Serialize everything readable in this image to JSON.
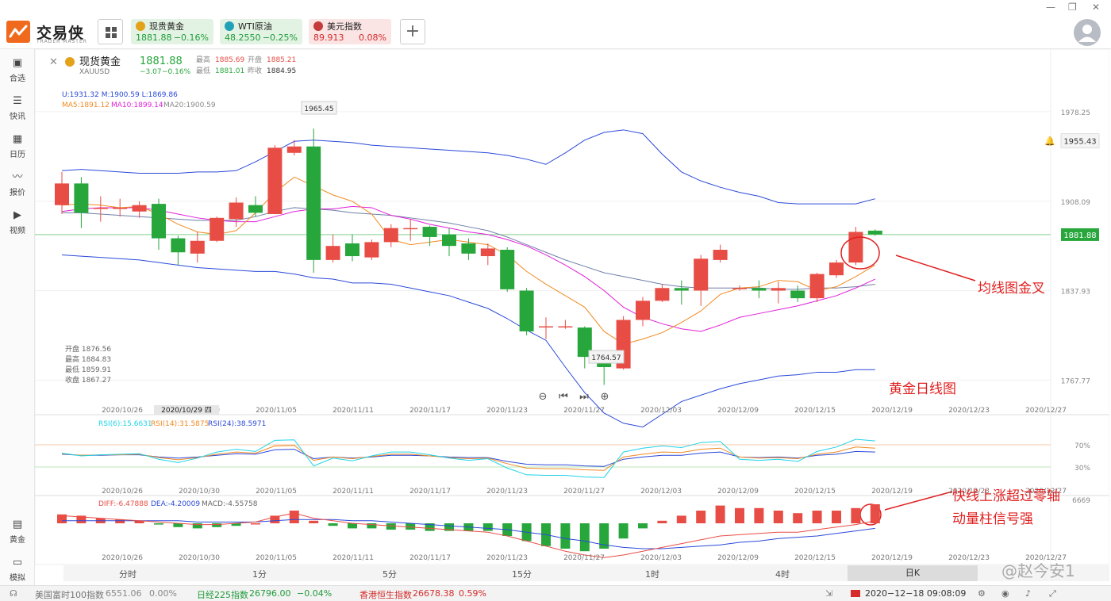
{
  "app": {
    "logo_text": "交易侠",
    "logo_sub": "TRADER MASTER",
    "plus_label": "+",
    "window_controls": [
      "—",
      "❐",
      "✕"
    ]
  },
  "tickers": [
    {
      "name": "现贵黄金",
      "price": "1881.88",
      "change": "−0.16%",
      "bg": "#e3f3e3",
      "price_color": "#1f9b3a",
      "icon_color": "#e3a21a"
    },
    {
      "name": "WTI原油",
      "price": "48.2550",
      "change": "−0.25%",
      "bg": "#e3f3e3",
      "price_color": "#1f9b3a",
      "icon_color": "#21a0b8"
    },
    {
      "name": "美元指数",
      "price": "89.913",
      "change": "0.08%",
      "bg": "#fbe4e4",
      "price_color": "#d52b2b",
      "icon_color": "#c43b3b"
    }
  ],
  "sidebar": {
    "items": [
      {
        "label": "合选",
        "icon": "bookmark-icon"
      },
      {
        "label": "快讯",
        "icon": "news-icon"
      },
      {
        "label": "日历",
        "icon": "calendar-icon"
      },
      {
        "label": "报价",
        "icon": "trend-icon"
      },
      {
        "label": "视频",
        "icon": "video-icon"
      },
      {
        "label": "黄金",
        "icon": "calculator-icon"
      },
      {
        "label": "模拟",
        "icon": "wallet-icon"
      }
    ]
  },
  "header": {
    "symbol": "现货黄金",
    "symbol_code": "XAUUSD",
    "price": "1881.88",
    "change": "−3.07",
    "change_pct": "−0.16%",
    "high_label": "最高",
    "high": "1885.69",
    "open_label": "开盘",
    "open": "1885.21",
    "low_label": "最低",
    "low": "1881.01",
    "prev_label": "昨收",
    "prev": "1884.95"
  },
  "indicators": {
    "boll": "U:1931.32   M:1900.59   L:1869.86",
    "ma5": "MA5:1891.12",
    "ma10": "MA10:1899.14",
    "ma20": "MA20:1900.59",
    "rsi6": "RSI(6):15.6631",
    "rsi14": "RSI(14):31.5875",
    "rsi24": "RSI(24):38.5971",
    "diff": "DIFF:-6.47888",
    "dea": "DEA:-4.20009",
    "macd": "MACD:-4.55758"
  },
  "ohlc_panel": {
    "open": "开盘 1876.56",
    "high": "最高 1884.83",
    "low": "最低 1859.91",
    "close": "收盘 1867.27"
  },
  "price_axis": {
    "ticks": [
      "1978.25",
      "1908.09",
      "1837.93",
      "1767.77"
    ],
    "alert_price": "1955.43",
    "current_price": "1881.88",
    "high_marker": "1965.45",
    "low_marker": "1764.57"
  },
  "rsi_axis": {
    "ticks": [
      "70%",
      "30%"
    ]
  },
  "macd_axis": {
    "ticks": [
      "6669"
    ]
  },
  "dates": [
    "2020/10/26",
    "2020/10/30",
    "2020/11/05",
    "2020/11/11",
    "2020/11/17",
    "2020/11/23",
    "2020/11/27",
    "2020/12/03",
    "2020/12/09",
    "2020/12/15",
    "2020/12/19",
    "2020/12/23",
    "2020/12/27"
  ],
  "crosshair_date": "2020/10/29 四",
  "timeframes": [
    "分时",
    "1分",
    "5分",
    "15分",
    "1时",
    "4时",
    "日K"
  ],
  "annotations": {
    "golden_cross": "均线图金叉",
    "daily_chart": "黄金日线图",
    "macd_note_1": "快线上涨超过零轴",
    "macd_note_2": "动量柱信号强",
    "watermark": "@赵今安1"
  },
  "statusbar": {
    "items": [
      {
        "name": "美国富时100指数",
        "value": "6551.06",
        "change": "0.00%"
      },
      {
        "name": "日经225指数",
        "value": "26796.00",
        "change": "−0.04%"
      },
      {
        "name": "香港恒生指数",
        "value": "26678.38",
        "change": "0.59%"
      }
    ],
    "datetime": "2020−12−18 09:08:09"
  },
  "colors": {
    "up": "#e84d45",
    "down": "#27a63c",
    "boll": "#2b49d9",
    "ma5": "#f08a22",
    "ma10": "#e020d8",
    "ma20": "#6f7fa8",
    "rsi6": "#1fd3e8",
    "rsi14": "#f08a22",
    "rsi24": "#2b49d9"
  },
  "chart_data": {
    "type": "candlestick",
    "symbol": "XAUUSD",
    "timeframe": "日K",
    "ylim": [
      1755,
      1990
    ],
    "candles": [
      {
        "o": 1905,
        "h": 1931,
        "l": 1898,
        "c": 1922
      },
      {
        "o": 1922,
        "h": 1927,
        "l": 1887,
        "c": 1899
      },
      {
        "o": 1902,
        "h": 1912,
        "l": 1892,
        "c": 1903
      },
      {
        "o": 1902,
        "h": 1910,
        "l": 1896,
        "c": 1903
      },
      {
        "o": 1900,
        "h": 1908,
        "l": 1895,
        "c": 1905
      },
      {
        "o": 1906,
        "h": 1910,
        "l": 1870,
        "c": 1879
      },
      {
        "o": 1879,
        "h": 1881,
        "l": 1858,
        "c": 1868
      },
      {
        "o": 1867,
        "h": 1884,
        "l": 1860,
        "c": 1877
      },
      {
        "o": 1877,
        "h": 1896,
        "l": 1876,
        "c": 1895
      },
      {
        "o": 1894,
        "h": 1911,
        "l": 1888,
        "c": 1907
      },
      {
        "o": 1905,
        "h": 1912,
        "l": 1896,
        "c": 1899
      },
      {
        "o": 1898,
        "h": 1952,
        "l": 1898,
        "c": 1950
      },
      {
        "o": 1946,
        "h": 1956,
        "l": 1944,
        "c": 1951
      },
      {
        "o": 1951,
        "h": 1965,
        "l": 1852,
        "c": 1862
      },
      {
        "o": 1862,
        "h": 1882,
        "l": 1860,
        "c": 1873
      },
      {
        "o": 1875,
        "h": 1882,
        "l": 1861,
        "c": 1865
      },
      {
        "o": 1864,
        "h": 1878,
        "l": 1862,
        "c": 1876
      },
      {
        "o": 1876,
        "h": 1890,
        "l": 1872,
        "c": 1887
      },
      {
        "o": 1887,
        "h": 1894,
        "l": 1877,
        "c": 1887
      },
      {
        "o": 1888,
        "h": 1889,
        "l": 1873,
        "c": 1880
      },
      {
        "o": 1882,
        "h": 1887,
        "l": 1865,
        "c": 1873
      },
      {
        "o": 1875,
        "h": 1879,
        "l": 1862,
        "c": 1867
      },
      {
        "o": 1865,
        "h": 1875,
        "l": 1858,
        "c": 1871
      },
      {
        "o": 1870,
        "h": 1872,
        "l": 1837,
        "c": 1839
      },
      {
        "o": 1838,
        "h": 1840,
        "l": 1803,
        "c": 1806
      },
      {
        "o": 1810,
        "h": 1817,
        "l": 1800,
        "c": 1810
      },
      {
        "o": 1810,
        "h": 1815,
        "l": 1808,
        "c": 1810
      },
      {
        "o": 1809,
        "h": 1810,
        "l": 1777,
        "c": 1786
      },
      {
        "o": 1786,
        "h": 1791,
        "l": 1764,
        "c": 1778
      },
      {
        "o": 1777,
        "h": 1818,
        "l": 1776,
        "c": 1815
      },
      {
        "o": 1815,
        "h": 1833,
        "l": 1810,
        "c": 1830
      },
      {
        "o": 1830,
        "h": 1843,
        "l": 1829,
        "c": 1840
      },
      {
        "o": 1840,
        "h": 1846,
        "l": 1827,
        "c": 1838
      },
      {
        "o": 1838,
        "h": 1866,
        "l": 1826,
        "c": 1863
      },
      {
        "o": 1862,
        "h": 1874,
        "l": 1860,
        "c": 1870
      },
      {
        "o": 1840,
        "h": 1842,
        "l": 1838,
        "c": 1840
      },
      {
        "o": 1840,
        "h": 1846,
        "l": 1832,
        "c": 1838
      },
      {
        "o": 1838,
        "h": 1845,
        "l": 1828,
        "c": 1840
      },
      {
        "o": 1838,
        "h": 1842,
        "l": 1829,
        "c": 1832
      },
      {
        "o": 1832,
        "h": 1852,
        "l": 1829,
        "c": 1851
      },
      {
        "o": 1850,
        "h": 1862,
        "l": 1848,
        "c": 1860
      },
      {
        "o": 1860,
        "h": 1888,
        "l": 1858,
        "c": 1884
      },
      {
        "o": 1885,
        "h": 1886,
        "l": 1881,
        "c": 1882
      }
    ],
    "bollinger": {
      "upper": [
        1932,
        1933,
        1932,
        1931,
        1930,
        1930,
        1930,
        1931,
        1931,
        1932,
        1939,
        1947,
        1955,
        1956,
        1955,
        1954,
        1952,
        1951,
        1950,
        1949,
        1948,
        1947,
        1946,
        1944,
        1941,
        1937,
        1946,
        1956,
        1962,
        1964,
        1961,
        1945,
        1931,
        1924,
        1919,
        1915,
        1912,
        1907,
        1906,
        1906,
        1906,
        1906,
        1910
      ],
      "middle": [
        1899,
        1899,
        1898,
        1897,
        1896,
        1895,
        1894,
        1893,
        1893,
        1893,
        1896,
        1900,
        1903,
        1902,
        1901,
        1899,
        1898,
        1897,
        1895,
        1893,
        1891,
        1888,
        1885,
        1880,
        1874,
        1868,
        1862,
        1857,
        1852,
        1849,
        1846,
        1843,
        1841,
        1840,
        1840,
        1840,
        1840,
        1839,
        1839,
        1840,
        1840,
        1841,
        1843
      ],
      "lower": [
        1866,
        1865,
        1864,
        1863,
        1862,
        1860,
        1858,
        1856,
        1855,
        1854,
        1853,
        1853,
        1851,
        1848,
        1847,
        1844,
        1844,
        1843,
        1840,
        1837,
        1834,
        1829,
        1824,
        1816,
        1807,
        1799,
        1778,
        1758,
        1742,
        1734,
        1731,
        1741,
        1751,
        1756,
        1761,
        1765,
        1768,
        1771,
        1772,
        1774,
        1774,
        1776,
        1776
      ]
    },
    "ma5": [
      1905,
      1906,
      1905,
      1903,
      1904,
      1898,
      1890,
      1884,
      1882,
      1885,
      1899,
      1915,
      1927,
      1920,
      1913,
      1908,
      1898,
      1878,
      1874,
      1876,
      1878,
      1876,
      1874,
      1866,
      1853,
      1843,
      1834,
      1825,
      1806,
      1796,
      1800,
      1805,
      1813,
      1822,
      1835,
      1840,
      1841,
      1846,
      1845,
      1838,
      1841,
      1849,
      1858
    ],
    "ma10": [
      1900,
      1902,
      1903,
      1903,
      1903,
      1901,
      1898,
      1895,
      1893,
      1892,
      1892,
      1896,
      1900,
      1902,
      1902,
      1904,
      1903,
      1897,
      1894,
      1890,
      1887,
      1884,
      1882,
      1878,
      1873,
      1866,
      1858,
      1849,
      1838,
      1825,
      1817,
      1812,
      1808,
      1806,
      1811,
      1817,
      1820,
      1823,
      1826,
      1830,
      1834,
      1840,
      1847
    ],
    "rsi": {
      "rsi6": [
        55,
        50,
        52,
        53,
        54,
        44,
        38,
        46,
        57,
        62,
        58,
        78,
        79,
        32,
        46,
        41,
        50,
        57,
        57,
        52,
        46,
        42,
        45,
        28,
        16,
        15,
        15,
        12,
        11,
        57,
        64,
        68,
        65,
        74,
        76,
        44,
        42,
        44,
        40,
        58,
        66,
        80,
        77
      ],
      "rsi14": [
        54,
        51,
        52,
        52,
        53,
        47,
        43,
        47,
        53,
        57,
        55,
        68,
        69,
        42,
        48,
        45,
        49,
        53,
        53,
        50,
        47,
        45,
        46,
        36,
        28,
        27,
        27,
        25,
        24,
        48,
        53,
        57,
        56,
        62,
        64,
        48,
        46,
        47,
        45,
        53,
        57,
        66,
        64
      ],
      "rsi24": [
        53,
        51,
        51,
        52,
        52,
        48,
        46,
        48,
        51,
        54,
        53,
        61,
        62,
        45,
        48,
        46,
        48,
        51,
        51,
        50,
        48,
        47,
        47,
        40,
        35,
        34,
        34,
        32,
        31,
        44,
        48,
        51,
        51,
        55,
        57,
        48,
        47,
        48,
        46,
        51,
        53,
        58,
        57
      ]
    },
    "macd": {
      "diff": [
        6,
        5,
        4,
        3,
        2,
        1,
        0,
        -1,
        -1,
        0,
        1,
        5,
        8,
        4,
        2,
        0,
        -1,
        -2,
        -3,
        -4,
        -5,
        -6,
        -7,
        -10,
        -14,
        -18,
        -22,
        -25,
        -27,
        -25,
        -22,
        -19,
        -16,
        -13,
        -10,
        -9,
        -8,
        -7,
        -7,
        -5,
        -3,
        -1,
        2
      ],
      "dea": [
        2,
        2,
        2,
        2,
        2,
        2,
        2,
        1,
        1,
        1,
        1,
        2,
        3,
        3,
        3,
        2,
        2,
        1,
        0,
        -1,
        -2,
        -3,
        -4,
        -5,
        -7,
        -9,
        -12,
        -14,
        -17,
        -19,
        -20,
        -20,
        -19,
        -18,
        -17,
        -15,
        -14,
        -12,
        -11,
        -10,
        -8,
        -6,
        -4
      ],
      "hist": [
        7,
        6,
        4,
        3,
        2,
        -1,
        -3,
        -4,
        -3,
        -2,
        0,
        6,
        10,
        2,
        -2,
        -4,
        -4,
        -5,
        -5,
        -6,
        -6,
        -6,
        -6,
        -10,
        -14,
        -18,
        -20,
        -22,
        -20,
        -12,
        -4,
        2,
        6,
        10,
        14,
        12,
        12,
        10,
        8,
        10,
        10,
        12,
        15
      ]
    }
  }
}
